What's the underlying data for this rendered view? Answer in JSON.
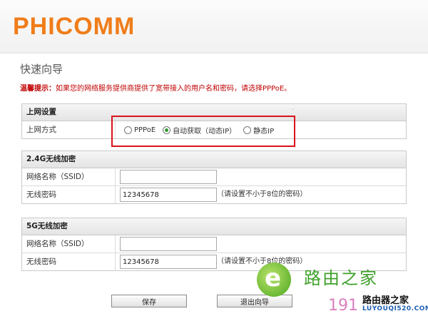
{
  "brand": {
    "logo_text": "PHICOMM",
    "logo_color": "#f07d1a"
  },
  "page": {
    "title": "快速向导",
    "tip_label": "温馨提示：",
    "tip_text": "如果您的网络服务提供商提供了宽带接入的用户名和密码，请选择PPPoE。"
  },
  "internet": {
    "heading": "上网设置",
    "mode_label": "上网方式",
    "options": [
      {
        "label": "PPPoE",
        "checked": false
      },
      {
        "label": "自动获取（动态IP）",
        "checked": true
      },
      {
        "label": "静态IP",
        "checked": false
      }
    ]
  },
  "wifi24": {
    "heading": "2.4G无线加密",
    "ssid_label": "网络名称（SSID）",
    "ssid_value": "",
    "password_label": "无线密码",
    "password_value": "12345678",
    "password_hint": "（请设置不小于8位的密码）"
  },
  "wifi5": {
    "heading": "5G无线加密",
    "ssid_label": "网络名称（SSID）",
    "ssid_value": "",
    "password_label": "无线密码",
    "password_value": "12345678",
    "password_hint": "（请设置不小于8位的密码）"
  },
  "buttons": {
    "save": "保存",
    "exit": "退出向导"
  },
  "watermark": {
    "site_name": "路由之家",
    "number": "191",
    "site_name2": "路由器之家",
    "url": "LUYOUQI520.COM"
  },
  "colors": {
    "highlight": "#d9121b",
    "tip": "#c00000",
    "radio_checked": "#2e9b2e"
  }
}
